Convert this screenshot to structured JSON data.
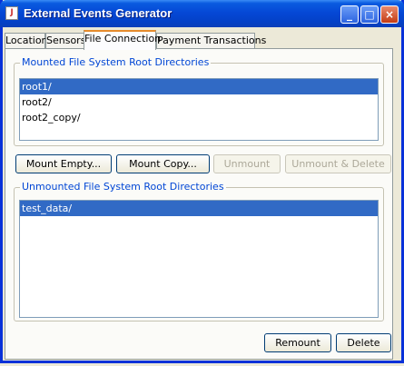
{
  "window": {
    "title": "External Events Generator"
  },
  "titlebar": {
    "minimize": "_",
    "maximize": "□",
    "close": "×"
  },
  "tabs": [
    {
      "label": "Location"
    },
    {
      "label": "Sensors"
    },
    {
      "label": "File Connection"
    },
    {
      "label": "Payment Transactions"
    }
  ],
  "mounted": {
    "title": "Mounted File System Root Directories",
    "items": [
      "root1/",
      "root2/",
      "root2_copy/"
    ],
    "selected_index": 0
  },
  "actions": {
    "mount_empty": "Mount Empty...",
    "mount_copy": "Mount Copy...",
    "unmount": "Unmount",
    "unmount_delete": "Unmount & Delete"
  },
  "unmounted": {
    "title": "Unmounted File System Root Directories",
    "items": [
      "test_data/"
    ],
    "selected_index": 0
  },
  "footer": {
    "remount": "Remount",
    "delete": "Delete"
  }
}
